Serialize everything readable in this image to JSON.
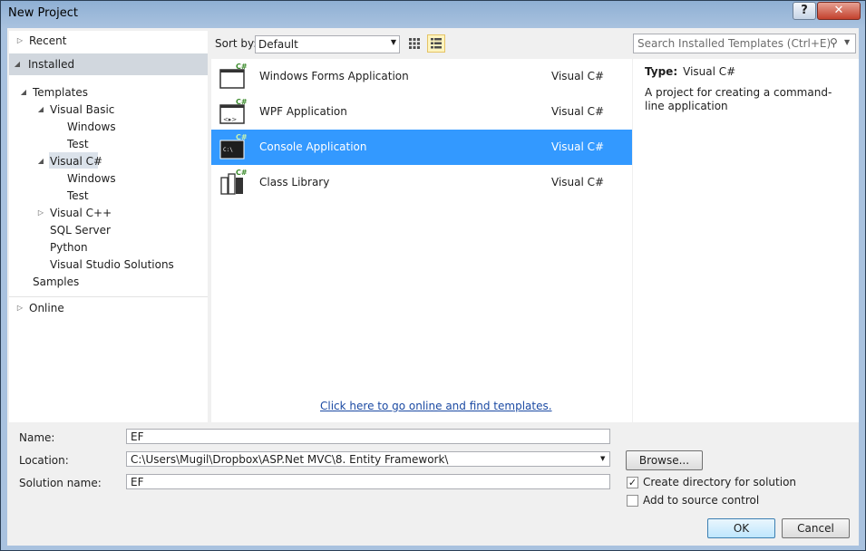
{
  "window": {
    "title": "New Project"
  },
  "tree": {
    "recent": "Recent",
    "installed": "Installed",
    "templates": "Templates",
    "visual_basic": "Visual Basic",
    "vb_windows": "Windows",
    "vb_test": "Test",
    "visual_csharp": "Visual C#",
    "cs_windows": "Windows",
    "cs_test": "Test",
    "visual_cpp": "Visual C++",
    "sql_server": "SQL Server",
    "python": "Python",
    "vs_solutions": "Visual Studio Solutions",
    "samples": "Samples",
    "online": "Online"
  },
  "toolbar": {
    "sort_label": "Sort by:",
    "sort_value": "Default",
    "search_placeholder": "Search Installed Templates (Ctrl+E)"
  },
  "templates": [
    {
      "name": "Windows Forms Application",
      "lang": "Visual C#",
      "icon": "windows-forms-icon"
    },
    {
      "name": "WPF Application",
      "lang": "Visual C#",
      "icon": "wpf-icon"
    },
    {
      "name": "Console Application",
      "lang": "Visual C#",
      "icon": "console-icon",
      "selected": true
    },
    {
      "name": "Class Library",
      "lang": "Visual C#",
      "icon": "class-library-icon"
    }
  ],
  "online_link": "Click here to go online and find templates.",
  "description": {
    "type_label": "Type:",
    "type_value": "Visual C#",
    "text": "A project for creating a command-line application"
  },
  "form": {
    "name_label": "Name:",
    "name_value": "EF",
    "location_label": "Location:",
    "location_value": "C:\\Users\\Mugil\\Dropbox\\ASP.Net MVC\\8. Entity Framework\\",
    "solution_label": "Solution name:",
    "solution_value": "EF",
    "browse": "Browse...",
    "create_dir": "Create directory for solution",
    "create_dir_checked": true,
    "source_control": "Add to source control",
    "source_control_checked": false,
    "ok": "OK",
    "cancel": "Cancel"
  },
  "colors": {
    "selection": "#3399ff",
    "link": "#1b4aa3"
  }
}
